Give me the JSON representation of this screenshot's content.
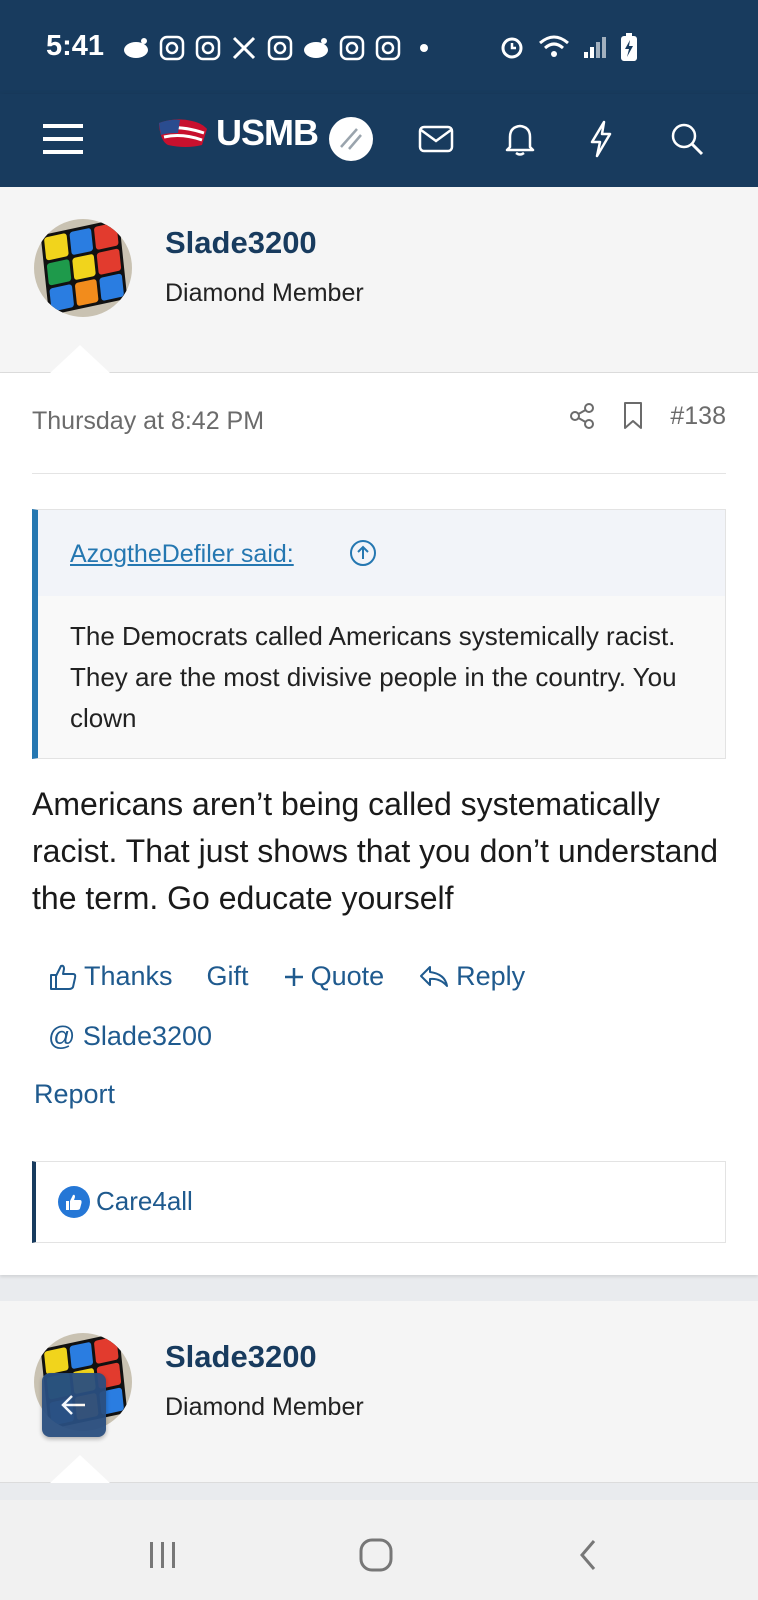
{
  "status_bar": {
    "time": "5:41",
    "icons_left": [
      "reddit-icon",
      "instagram-icon",
      "instagram-icon",
      "x-icon",
      "instagram-icon",
      "reddit-icon",
      "instagram-icon",
      "instagram-icon",
      "dot-icon"
    ],
    "icons_right": [
      "alarm-icon",
      "wifi-icon",
      "signal-icon",
      "battery-charging-icon"
    ]
  },
  "navbar": {
    "logo_text": "USMB",
    "icons": [
      "menu-icon",
      "flag-icon",
      "avatar-icon",
      "mail-icon",
      "bell-icon",
      "bolt-icon",
      "search-icon"
    ]
  },
  "post": {
    "username": "Slade3200",
    "user_title": "Diamond Member",
    "date": "Thursday at 8:42 PM",
    "post_number": "#138",
    "quote": {
      "author": "AzogtheDefiler said:",
      "text": "The Democrats called Americans systemically racist. They are the most divisive people in the country. You clown"
    },
    "message": "Americans aren’t being called systematically racist. That just shows that you don’t understand the term. Go educate yourself",
    "actions": {
      "thanks": "Thanks",
      "gift": "Gift",
      "quote": "Quote",
      "reply": "Reply",
      "mention": "@ Slade3200",
      "report": "Report"
    },
    "reactions": {
      "users": "Care4all"
    }
  },
  "next_post": {
    "username": "Slade3200",
    "user_title": "Diamond Member"
  },
  "colors": {
    "header_bg": "#183b5e",
    "link": "#1f5a8e",
    "quote_border": "#2577b1"
  }
}
